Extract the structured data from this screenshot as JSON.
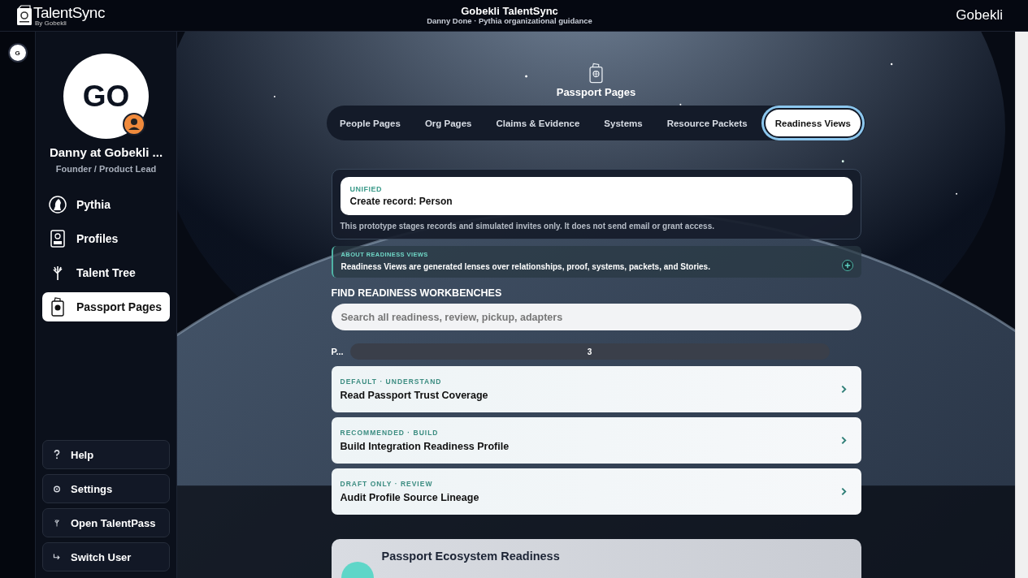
{
  "header": {
    "logo_title": "TalentSync",
    "logo_subtitle": "By Gobekli",
    "title": "Gobekli TalentSync",
    "subtitle": "Danny Done · Pythia organizational guidance",
    "brand": "Gobekli"
  },
  "rail": {
    "avatar": "G"
  },
  "profile": {
    "initials": "GO",
    "name": "Danny at Gobekli ...",
    "role": "Founder / Product Lead"
  },
  "nav": [
    {
      "label": "Pythia",
      "kind": "oracle",
      "selected": false
    },
    {
      "label": "Profiles",
      "kind": "profile",
      "selected": false
    },
    {
      "label": "Talent Tree",
      "kind": "tree",
      "selected": false
    },
    {
      "label": "Passport Pages",
      "kind": "passport",
      "selected": true
    }
  ],
  "footer_buttons": [
    {
      "label": "Help",
      "kind": "help"
    },
    {
      "label": "Settings",
      "kind": "settings"
    },
    {
      "label": "Open TalentPass",
      "kind": "tree"
    },
    {
      "label": "Switch User",
      "kind": "switch"
    }
  ],
  "page": {
    "title": "Passport Pages"
  },
  "tabs": [
    {
      "label": "People Pages",
      "selected": false
    },
    {
      "label": "Org Pages",
      "selected": false
    },
    {
      "label": "Claims & Evidence",
      "selected": false
    },
    {
      "label": "Systems",
      "selected": false
    },
    {
      "label": "Resource Packets",
      "selected": false
    },
    {
      "label": "Readiness Views",
      "selected": true
    }
  ],
  "record": {
    "eyebrow": "UNIFIED",
    "title": "Create record: Person",
    "note": "This prototype stages records and simulated invites only. It does not send email or grant access."
  },
  "about": {
    "eyebrow": "ABOUT READINESS VIEWS",
    "text": "Readiness Views are generated lenses over relationships, proof, systems, packets, and Stories.",
    "expanded": false
  },
  "finder": {
    "heading": "FIND READINESS WORKBENCHES",
    "placeholder": "Search all readiness, review, pickup, adapters",
    "filter_label": "P...",
    "count": "3"
  },
  "workbenches": [
    {
      "eyebrow": "DEFAULT · UNDERSTAND",
      "title": "Read Passport Trust Coverage"
    },
    {
      "eyebrow": "RECOMMENDED · BUILD",
      "title": "Build Integration Readiness Profile"
    },
    {
      "eyebrow": "DRAFT ONLY · REVIEW",
      "title": "Audit Profile Source Lineage"
    }
  ],
  "bottom_card": {
    "title": "Passport Ecosystem Readiness"
  }
}
